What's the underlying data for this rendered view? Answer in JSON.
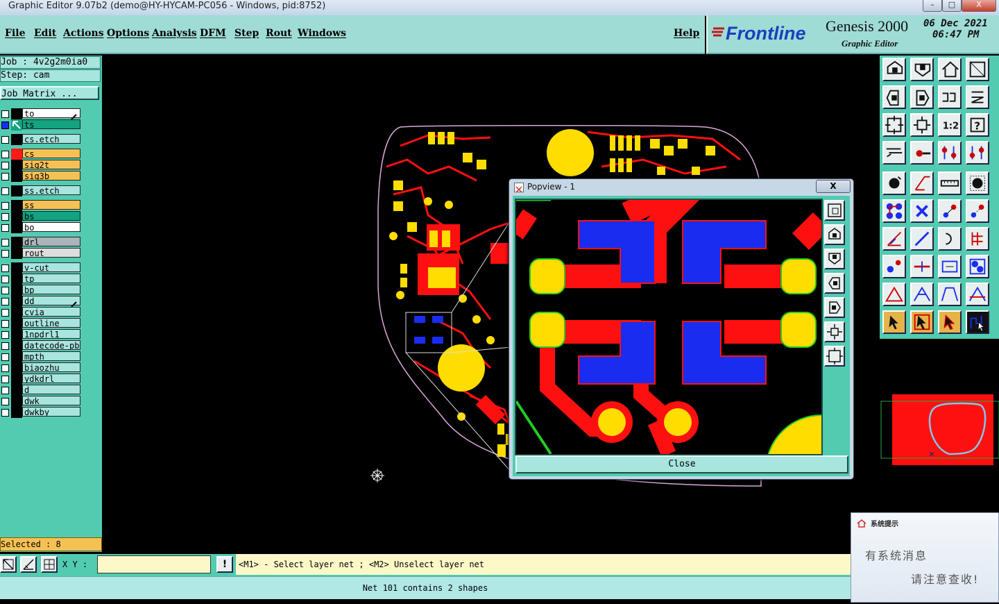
{
  "window": {
    "title": "Graphic Editor 9.07b2 (demo@HY-HYCAM-PC056 - Windows, pid:8752)",
    "minimize": "–",
    "maximize": "□",
    "close": "X"
  },
  "menu": {
    "items": [
      "File",
      "Edit",
      "Actions",
      "Options",
      "Analysis",
      "DFM",
      "Step",
      "Rout",
      "Windows"
    ],
    "help": "Help"
  },
  "brand": {
    "logo": "Frontline",
    "product": "Genesis 2000",
    "subtitle": "Graphic Editor",
    "date": "06 Dec 2021",
    "time": "06:47 PM"
  },
  "job": {
    "job_label": "Job : 4v2g2m0ia0",
    "step_label": "Step: cam",
    "matrix_button": "Job Matrix ..."
  },
  "layers": [
    {
      "name": "to",
      "color": "#ffffff",
      "swatch": "#000000",
      "mark": "pen"
    },
    {
      "name": "ts",
      "color": "#13a37f",
      "swatch": "#13a37f",
      "mark": "arrow",
      "active": true
    },
    {
      "name": "cs.etch",
      "color": "#a8e5df",
      "swatch": "#000000"
    },
    {
      "name": "cs",
      "color": "#f6c154",
      "swatch": "#ff1a1a"
    },
    {
      "name": "sig2t",
      "color": "#f6c154",
      "swatch": "#000000"
    },
    {
      "name": "sig3b",
      "color": "#f6c154",
      "swatch": "#000000"
    },
    {
      "name": "ss.etch",
      "color": "#a8e5df",
      "swatch": "#000000"
    },
    {
      "name": "ss",
      "color": "#f6c154",
      "swatch": "#000000"
    },
    {
      "name": "bs",
      "color": "#13a37f",
      "swatch": "#000000"
    },
    {
      "name": "bo",
      "color": "#ffffff",
      "swatch": "#000000"
    },
    {
      "name": "drl",
      "color": "#a9b5b8",
      "swatch": "#000000"
    },
    {
      "name": "rout",
      "color": "#dddddd",
      "swatch": "#000000"
    },
    {
      "name": "v-cut",
      "color": "#a8e5df",
      "swatch": "#000000"
    },
    {
      "name": "tp",
      "color": "#a8e5df",
      "swatch": "#000000"
    },
    {
      "name": "bp",
      "color": "#a8e5df",
      "swatch": "#000000"
    },
    {
      "name": "dd",
      "color": "#a8e5df",
      "swatch": "#000000",
      "mark": "pen"
    },
    {
      "name": "cvia",
      "color": "#a8e5df",
      "swatch": "#000000"
    },
    {
      "name": "outline",
      "color": "#a8e5df",
      "swatch": "#000000"
    },
    {
      "name": "1npdrl1",
      "color": "#a8e5df",
      "swatch": "#000000"
    },
    {
      "name": "datecode-pbc",
      "color": "#a8e5df",
      "swatch": "#000000"
    },
    {
      "name": "mpth",
      "color": "#a8e5df",
      "swatch": "#000000"
    },
    {
      "name": "biaozhu",
      "color": "#a8e5df",
      "swatch": "#000000"
    },
    {
      "name": "ydkdrl",
      "color": "#a8e5df",
      "swatch": "#000000"
    },
    {
      "name": "d",
      "color": "#a8e5df",
      "swatch": "#000000"
    },
    {
      "name": "dwk",
      "color": "#a8e5df",
      "swatch": "#000000"
    },
    {
      "name": "dwkby",
      "color": "#a8e5df",
      "swatch": "#000000"
    }
  ],
  "selected_label": "Selected : 8",
  "popview": {
    "title": "Popview - 1",
    "close_x": "X",
    "close_button": "Close",
    "side_icons": [
      "fit-window-icon",
      "pan-up-icon",
      "pan-down-icon",
      "pan-left-icon",
      "pan-right-icon",
      "zoom-out-icon",
      "zoom-in-icon"
    ]
  },
  "toolbar_icons": [
    "pan-up-icon",
    "pan-down-icon",
    "home-icon",
    "zoom-window-icon",
    "pan-left-icon",
    "pan-right-icon",
    "redraw-icon",
    "layers-icon",
    "zoom-in-icon",
    "zoom-out-icon",
    "one-to-one-icon",
    "help-icon",
    "measure-icon",
    "snap-icon",
    "net-select-icon",
    "net-connect-icon",
    "add-pad-icon",
    "add-line-icon",
    "ruler-icon",
    "add-circle-icon",
    "add-net-icon",
    "delete-icon",
    "move-icon",
    "copy-icon",
    "line-icon",
    "diagonal-line-icon",
    "arc-icon",
    "split-icon",
    "resize-icon",
    "flip-icon",
    "stretch-icon",
    "array-icon",
    "polygon-icon",
    "polygon2-icon",
    "polygon3-icon",
    "polygon4-icon",
    "select-icon",
    "select-net-icon",
    "select-feature-icon",
    "select-layer-net-icon"
  ],
  "status": {
    "xy_label": "X Y :",
    "xy_value": "",
    "message": "<M1> - Select layer net ; <M2> Unselect layer net",
    "bottom": "Net 101 contains 2 shapes",
    "warning": "!"
  },
  "notification": {
    "title": "系统提示",
    "line1": "有系统消息",
    "line2": "请注意查收!"
  },
  "colors": {
    "panel": "#52cbb1",
    "menubar": "#9fdcd6",
    "pcb_red": "#ff0000",
    "pcb_yellow": "#ffdd00",
    "pcb_blue": "#1a2cf0",
    "pcb_green": "#22cc22"
  }
}
